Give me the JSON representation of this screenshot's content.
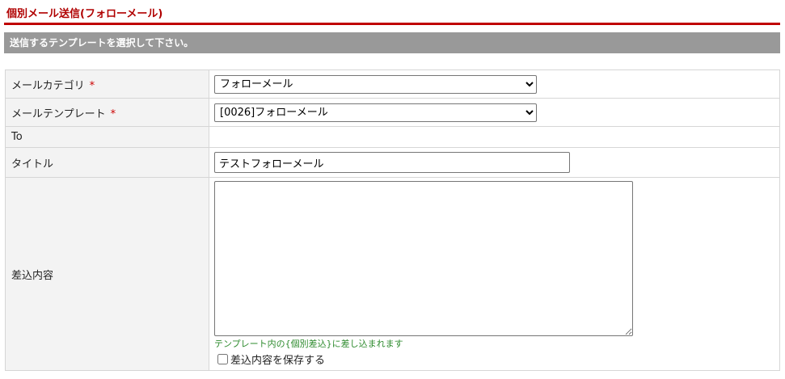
{
  "page": {
    "title": "個別メール送信(フォローメール)",
    "subheading": "送信するテンプレートを選択して下さい。"
  },
  "form": {
    "required_mark": "*",
    "category": {
      "label": "メールカテゴリ",
      "value": "フォローメール"
    },
    "template": {
      "label": "メールテンプレート",
      "value": "[0026]フォローメール"
    },
    "to": {
      "label": "To",
      "value": ""
    },
    "subject": {
      "label": "タイトル",
      "value": "テストフォローメール"
    },
    "insert": {
      "label": "差込内容",
      "value": "",
      "hint": "テンプレート内の{個別差込}に差し込まれます",
      "save_label": "差込内容を保存する",
      "save_checked": false
    }
  },
  "colors": {
    "accent": "#c00000",
    "title_text": "#b00000",
    "subhead_bg": "#999999",
    "hint_text": "#2e8b2e",
    "required": "#cc0000"
  }
}
